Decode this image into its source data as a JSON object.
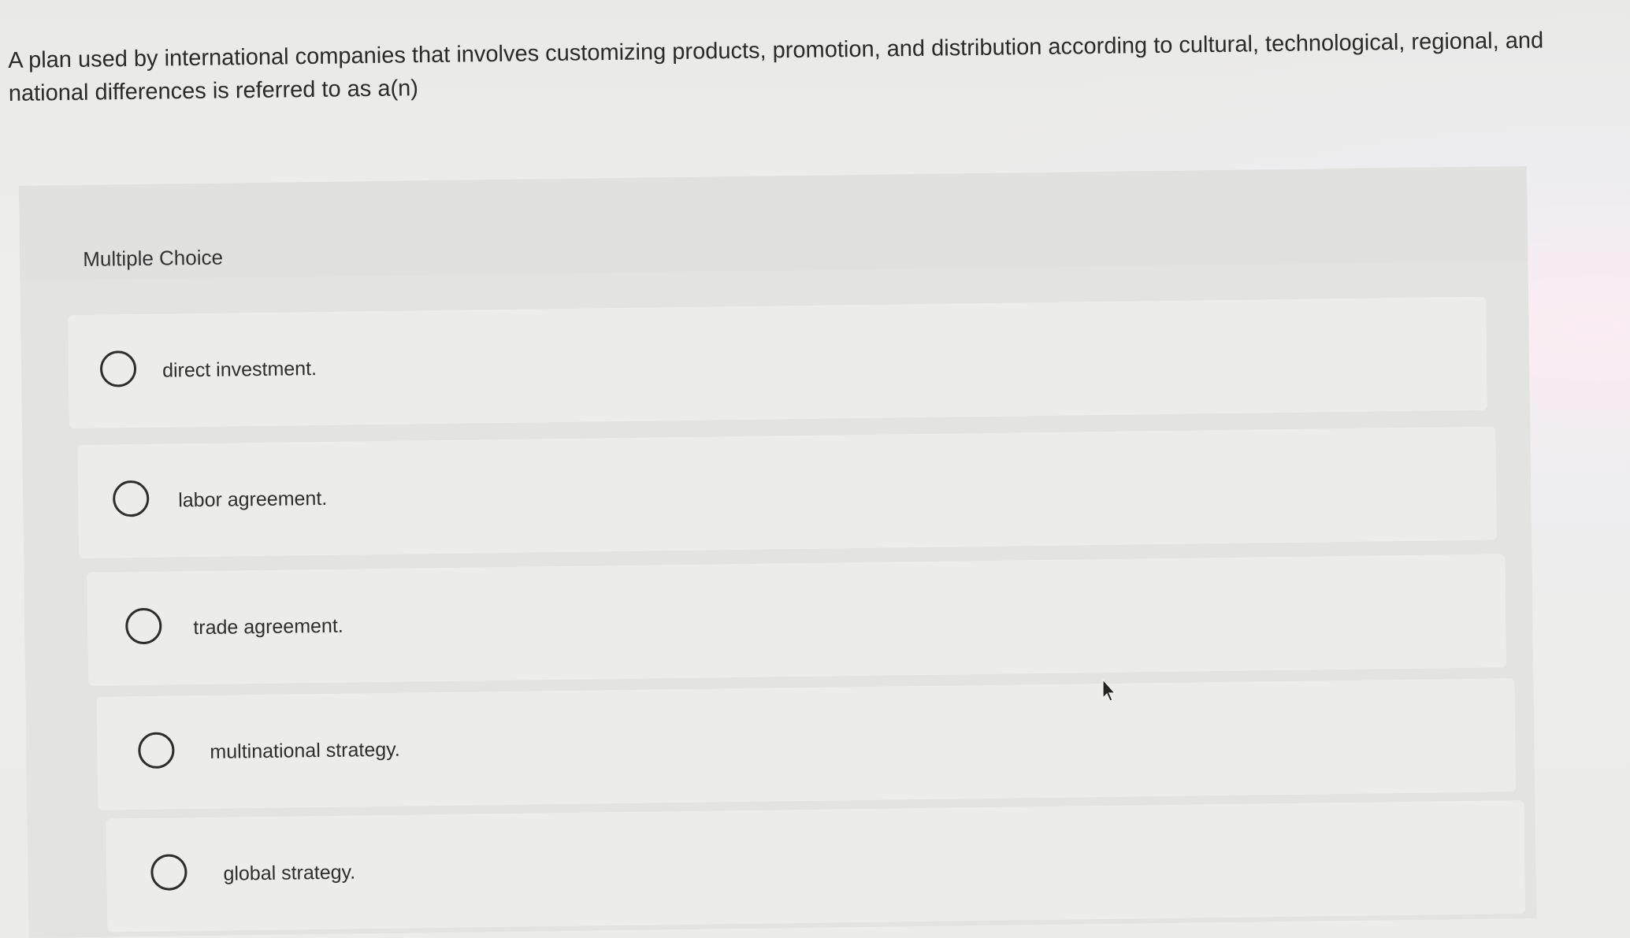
{
  "question": {
    "text": "A plan used by international companies that involves customizing products, promotion, and distribution according to cultural, technological, regional, and national differences is referred to as a(n)"
  },
  "question_type": {
    "label": "Multiple Choice"
  },
  "options": [
    {
      "label": "direct investment.",
      "icon": "radio-unselected"
    },
    {
      "label": "labor agreement.",
      "icon": "radio-unselected"
    },
    {
      "label": "trade agreement.",
      "icon": "radio-unselected"
    },
    {
      "label": "multinational strategy.",
      "icon": "radio-unselected"
    },
    {
      "label": "global strategy.",
      "icon": "radio-unselected"
    }
  ],
  "cursor": {
    "icon": "arrow-cursor-icon"
  }
}
